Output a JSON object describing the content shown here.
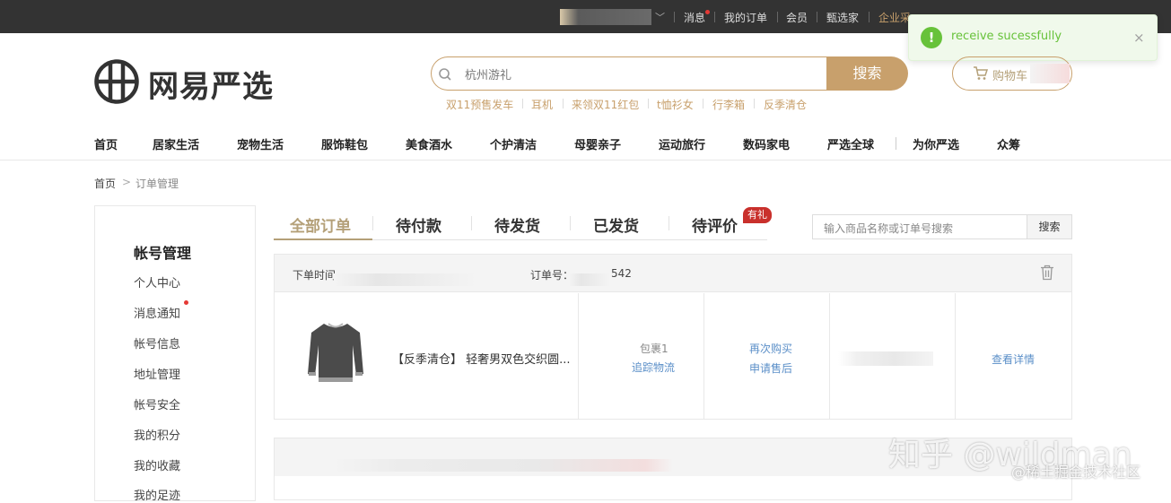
{
  "topbar": {
    "links": [
      "消息",
      "我的订单",
      "会员",
      "甄选家",
      "企业采"
    ],
    "chevron": "chevron-down-icon"
  },
  "toast": {
    "message": "receive sucessfully",
    "icon": "check-circle-icon",
    "close": "×",
    "color": "#67c23a"
  },
  "logo": {
    "text": "网易严选"
  },
  "search": {
    "placeholder": "杭州游礼",
    "button": "搜索",
    "hot_words": [
      "双11预售发车",
      "耳机",
      "来领双11红包",
      "t恤衫女",
      "行李箱",
      "反季清仓"
    ]
  },
  "cart": {
    "label": "购物车"
  },
  "nav": [
    "首页",
    "居家生活",
    "宠物生活",
    "服饰鞋包",
    "美食酒水",
    "个护清洁",
    "母婴亲子",
    "运动旅行",
    "数码家电",
    "严选全球",
    "为你严选",
    "众筹"
  ],
  "breadcrumb": {
    "home": "首页",
    "sep": ">",
    "current": "订单管理"
  },
  "sidebar": {
    "title": "帐号管理",
    "items": [
      "个人中心",
      "消息通知",
      "帐号信息",
      "地址管理",
      "帐号安全",
      "我的积分",
      "我的收藏",
      "我的足迹"
    ]
  },
  "tabs": [
    {
      "label": "全部订单",
      "active": true
    },
    {
      "label": "待付款",
      "active": false
    },
    {
      "label": "待发货",
      "active": false
    },
    {
      "label": "已发货",
      "active": false
    },
    {
      "label": "待评价",
      "active": false
    }
  ],
  "tab_badge": "有礼",
  "order_search": {
    "placeholder": "输入商品名称或订单号搜索",
    "button": "搜索"
  },
  "order": {
    "time_label": "下单时间",
    "number_label": "订单号：",
    "number_suffix": "542",
    "product_name": "【反季清仓】 轻奢男双色交织圆...",
    "package": "包裹1",
    "track": "追踪物流",
    "rebuy": "再次购买",
    "after_sale": "申请售后",
    "detail": "查看详情"
  },
  "watermark": {
    "main": "知乎 @wildman",
    "sub": "@稀土掘金技术社区"
  },
  "colors": {
    "accent": "#c8a06c",
    "link": "#5b8fc8",
    "topbar": "#333333"
  }
}
